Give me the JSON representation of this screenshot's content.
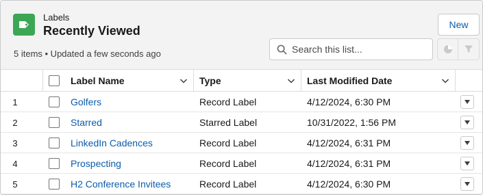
{
  "header": {
    "object_label": "Labels",
    "list_title": "Recently Viewed",
    "meta": "5 items • Updated a few seconds ago",
    "new_button": "New",
    "search_placeholder": "Search this list...",
    "icon_color": "#3ba755",
    "link_color": "#0b5cab"
  },
  "columns": [
    {
      "label": "Label Name"
    },
    {
      "label": "Type"
    },
    {
      "label": "Last Modified Date"
    }
  ],
  "rows": [
    {
      "num": "1",
      "name": "Golfers",
      "type": "Record Label",
      "date": "4/12/2024, 6:30 PM"
    },
    {
      "num": "2",
      "name": "Starred",
      "type": "Starred Label",
      "date": "10/31/2022, 1:56 PM"
    },
    {
      "num": "3",
      "name": "LinkedIn Cadences",
      "type": "Record Label",
      "date": "4/12/2024, 6:31 PM"
    },
    {
      "num": "4",
      "name": "Prospecting",
      "type": "Record Label",
      "date": "4/12/2024, 6:31 PM"
    },
    {
      "num": "5",
      "name": "H2 Conference Invitees",
      "type": "Record Label",
      "date": "4/12/2024, 6:30 PM"
    }
  ]
}
